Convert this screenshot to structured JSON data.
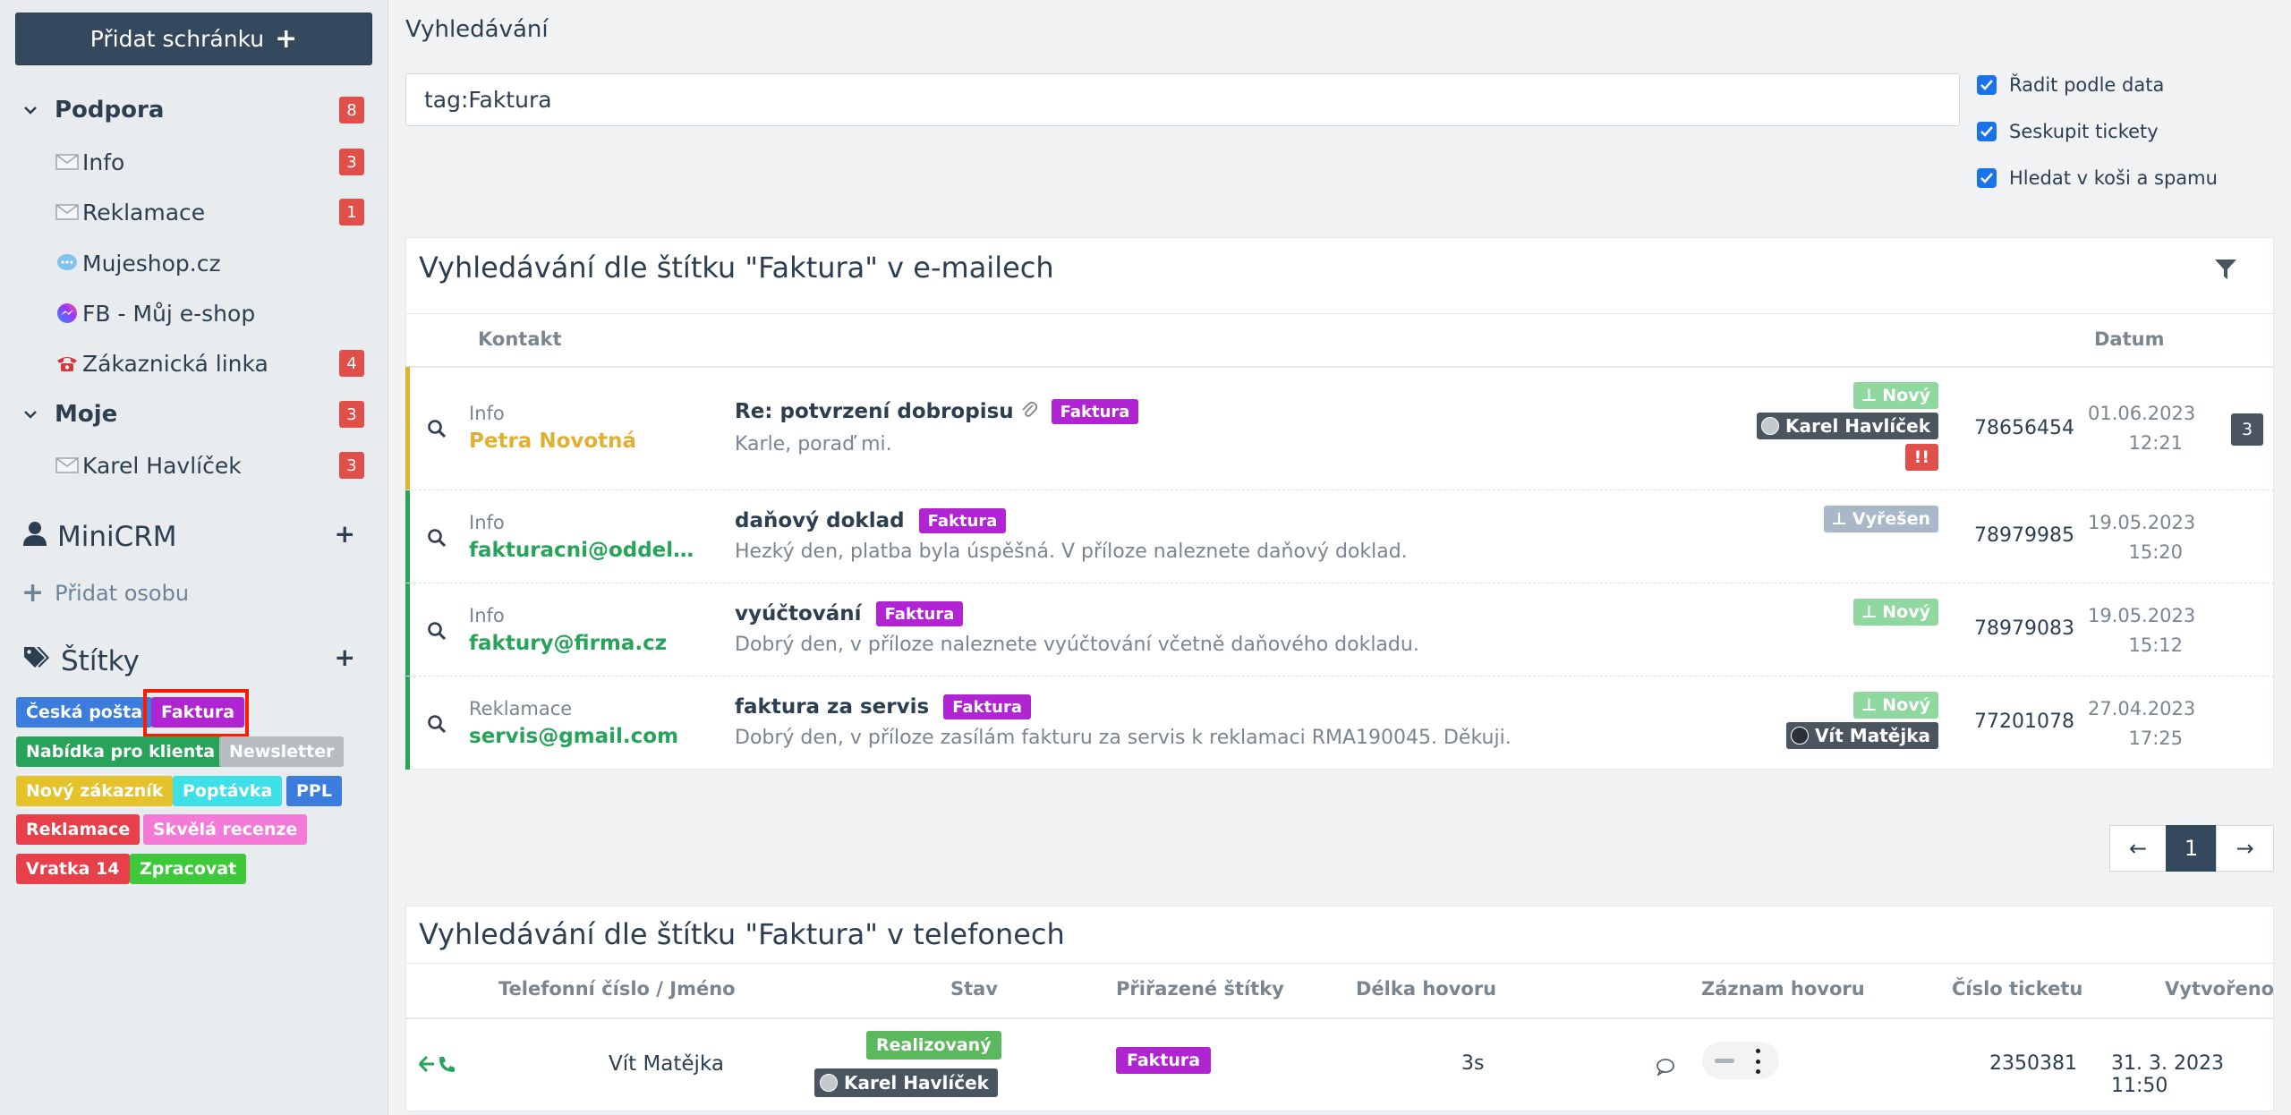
{
  "sidebar": {
    "add_mailbox_label": "Přidat schránku",
    "groups": [
      {
        "label": "Podpora",
        "badge": "8"
      },
      {
        "label": "Moje",
        "badge": "3"
      }
    ],
    "items": [
      {
        "label": "Info",
        "icon": "envelope-icon",
        "badge": "3"
      },
      {
        "label": "Reklamace",
        "icon": "envelope-icon",
        "badge": "1"
      },
      {
        "label": "Mujeshop.cz",
        "icon": "chat-bubble-icon",
        "badge": ""
      },
      {
        "label": "FB - Můj e-shop",
        "icon": "messenger-icon",
        "badge": ""
      },
      {
        "label": "Zákaznická linka",
        "icon": "phone-icon",
        "badge": "4"
      },
      {
        "label": "Karel Havlíček",
        "icon": "envelope-icon",
        "badge": "3"
      }
    ],
    "minicrm_title": "MiniCRM",
    "add_person_label": "Přidat osobu",
    "tags_title": "Štítky",
    "tags": [
      {
        "label": "Česká pošta",
        "color": "#3b7ddd"
      },
      {
        "label": "Faktura",
        "color": "#b024d1"
      },
      {
        "label": "Nabídka pro klienta",
        "color": "#27a35a"
      },
      {
        "label": "Newsletter",
        "color": "#b7bcc0"
      },
      {
        "label": "Nový zákazník",
        "color": "#e5c12a"
      },
      {
        "label": "Poptávka",
        "color": "#3ee0e8"
      },
      {
        "label": "PPL",
        "color": "#3b7ddd"
      },
      {
        "label": "Reklamace",
        "color": "#e8404a"
      },
      {
        "label": "Skvělá recenze",
        "color": "#f47ad8"
      },
      {
        "label": "Vratka 14",
        "color": "#e8404a"
      },
      {
        "label": "Zpracovat",
        "color": "#3ec93a"
      }
    ]
  },
  "main": {
    "title": "Vyhledávání",
    "search_value": "tag:Faktura",
    "options": [
      {
        "label": "Řadit podle data",
        "checked": true
      },
      {
        "label": "Seskupit tickety",
        "checked": true
      },
      {
        "label": "Hledat v koši a spamu",
        "checked": true
      }
    ]
  },
  "emails": {
    "title": "Vyhledávání dle štítku \"Faktura\" v e-mailech",
    "col_contact": "Kontakt",
    "col_date": "Datum",
    "rows": [
      {
        "mailbox": "Info",
        "contact": "Petra Novotná",
        "subject": "Re: potvrzení dobropisu",
        "tag": "Faktura",
        "preview": "Karle, poraď mi.",
        "status": "Nový",
        "agent": "Karel Havlíček",
        "priority": "!!",
        "ticket": "78656454",
        "date": "01.06.2023",
        "time": "12:21",
        "count": "3"
      },
      {
        "mailbox": "Info",
        "contact": "fakturacni@oddeleni...",
        "subject": "daňový doklad",
        "tag": "Faktura",
        "preview": "Hezký den, platba byla úspěšná. V příloze naleznete daňový doklad.",
        "status": "Vyřešen",
        "ticket": "78979985",
        "date": "19.05.2023",
        "time": "15:20"
      },
      {
        "mailbox": "Info",
        "contact": "faktury@firma.cz",
        "subject": "vyúčtování",
        "tag": "Faktura",
        "preview": "Dobrý den, v příloze naleznete vyúčtování včetně daňového dokladu.",
        "status": "Nový",
        "ticket": "78979083",
        "date": "19.05.2023",
        "time": "15:12"
      },
      {
        "mailbox": "Reklamace",
        "contact": "servis@gmail.com",
        "subject": "faktura za servis",
        "tag": "Faktura",
        "preview": "Dobrý den, v příloze zasílám fakturu za servis k reklamaci RMA190045. Děkuji.",
        "status": "Nový",
        "agent": "Vít Matějka",
        "ticket": "77201078",
        "date": "27.04.2023",
        "time": "17:25"
      }
    ],
    "pagination": {
      "prev": "←",
      "current": "1",
      "next": "→"
    }
  },
  "phones": {
    "title": "Vyhledávání dle štítku \"Faktura\" v telefonech",
    "columns": [
      "Telefonní číslo / Jméno",
      "Stav",
      "Přiřazené štítky",
      "Délka hovoru",
      "Záznam hovoru",
      "Číslo ticketu",
      "Vytvořeno"
    ],
    "row": {
      "name": "Vít Matějka",
      "status": "Realizovaný",
      "agent": "Karel Havlíček",
      "tag": "Faktura",
      "duration": "3s",
      "ticket": "2350381",
      "created": "31. 3. 2023 11:50"
    }
  },
  "colors": {
    "accent": "#34495e",
    "new_status": "#8fd9a0",
    "solved_status": "#a8b8c8",
    "green": "#27a35a",
    "yellow": "#e0b030"
  }
}
